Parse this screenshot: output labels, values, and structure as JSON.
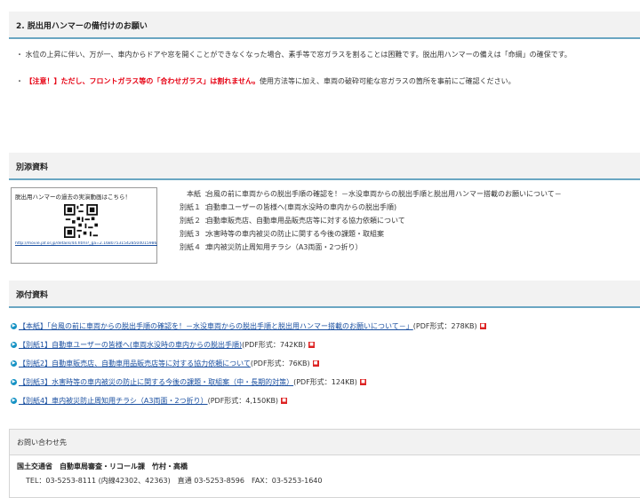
{
  "section2": {
    "title": "2. 脱出用ハンマーの備付けのお願い",
    "para1": "・ 水位の上昇に伴い、万が一、車内からドアや窓を開くことができなくなった場合、素手等で窓ガラスを割ることは困難です。脱出用ハンマーの備えは「命綱」の確保です。",
    "para2_bullet": "・ ",
    "para2_red": "【注意！】ただし、フロントガラス等の「合わせガラス」は割れません。",
    "para2_rest": "使用方法等に加え、車両の破砕可能な窓ガラスの箇所を事前にご確認ください。"
  },
  "annex": {
    "title": "別添資料",
    "qr_caption": "脱出用ハンマーの過去の実演動画はこちら！",
    "qr_link": "http://movie.jaf.or.jp/details/44.html?_ga=2.16807531542850401598680677-1544075791.1586105497(出典：JAF)",
    "items": [
      {
        "label": "本紙",
        "sep": "：",
        "text": "台風の前に車両からの脱出手順の確認を！－水没車両からの脱出手順と脱出用ハンマー搭載のお願いについて－"
      },
      {
        "label": "別紙１",
        "sep": "：",
        "text": "自動車ユーザーの皆様へ(車両水没時の車内からの脱出手順)"
      },
      {
        "label": "別紙２",
        "sep": "：",
        "text": "自動車販売店、自動車用品販売店等に対する協力依頼について"
      },
      {
        "label": "別紙３",
        "sep": "：",
        "text": "水害時等の車内被災の防止に関する今後の課題・取組案"
      },
      {
        "label": "別紙４",
        "sep": "：",
        "text": "車内被災防止周知用チラシ（A3両面・2つ折り）"
      }
    ]
  },
  "attachments": {
    "title": "添付資料",
    "items": [
      {
        "link": "【本紙】「台風の前に車両からの脱出手順の確認を！－水没車両からの脱出手順と脱出用ハンマー搭載のお願いについて－」",
        "info": "(PDF形式：278KB)"
      },
      {
        "link": "【別紙1】自動車ユーザーの皆様へ(車両水没時の車内からの脱出手順)",
        "info": "(PDF形式：742KB)"
      },
      {
        "link": "【別紙2】自動車販売店、自動車用品販売店等に対する協力依頼について",
        "info": "(PDF形式：76KB)"
      },
      {
        "link": "【別紙3】水害時等の車内被災の防止に関する今後の課題・取組案（中・長期的対策）",
        "info": "(PDF形式：124KB)"
      },
      {
        "link": "【別紙4】車内被災防止周知用チラシ（A3両面・2つ折り）",
        "info": "(PDF形式：4,150KB)"
      }
    ]
  },
  "contact": {
    "title": "お問い合わせ先",
    "org": "国土交通省　自動車局審査・リコール課　竹村・高橋",
    "tel": "TEL：03-5253-8111 (内線42302、42363)　直通 03-5253-8596　FAX：03-5253-1640"
  },
  "colors": {
    "accent": "#6aa6c2",
    "link": "#1a4fa0",
    "warning": "#e60012",
    "pdf_badge": "#dd2222"
  },
  "icons": {
    "bullet": "chevron-right-icon",
    "pdf": "pdf-icon"
  }
}
